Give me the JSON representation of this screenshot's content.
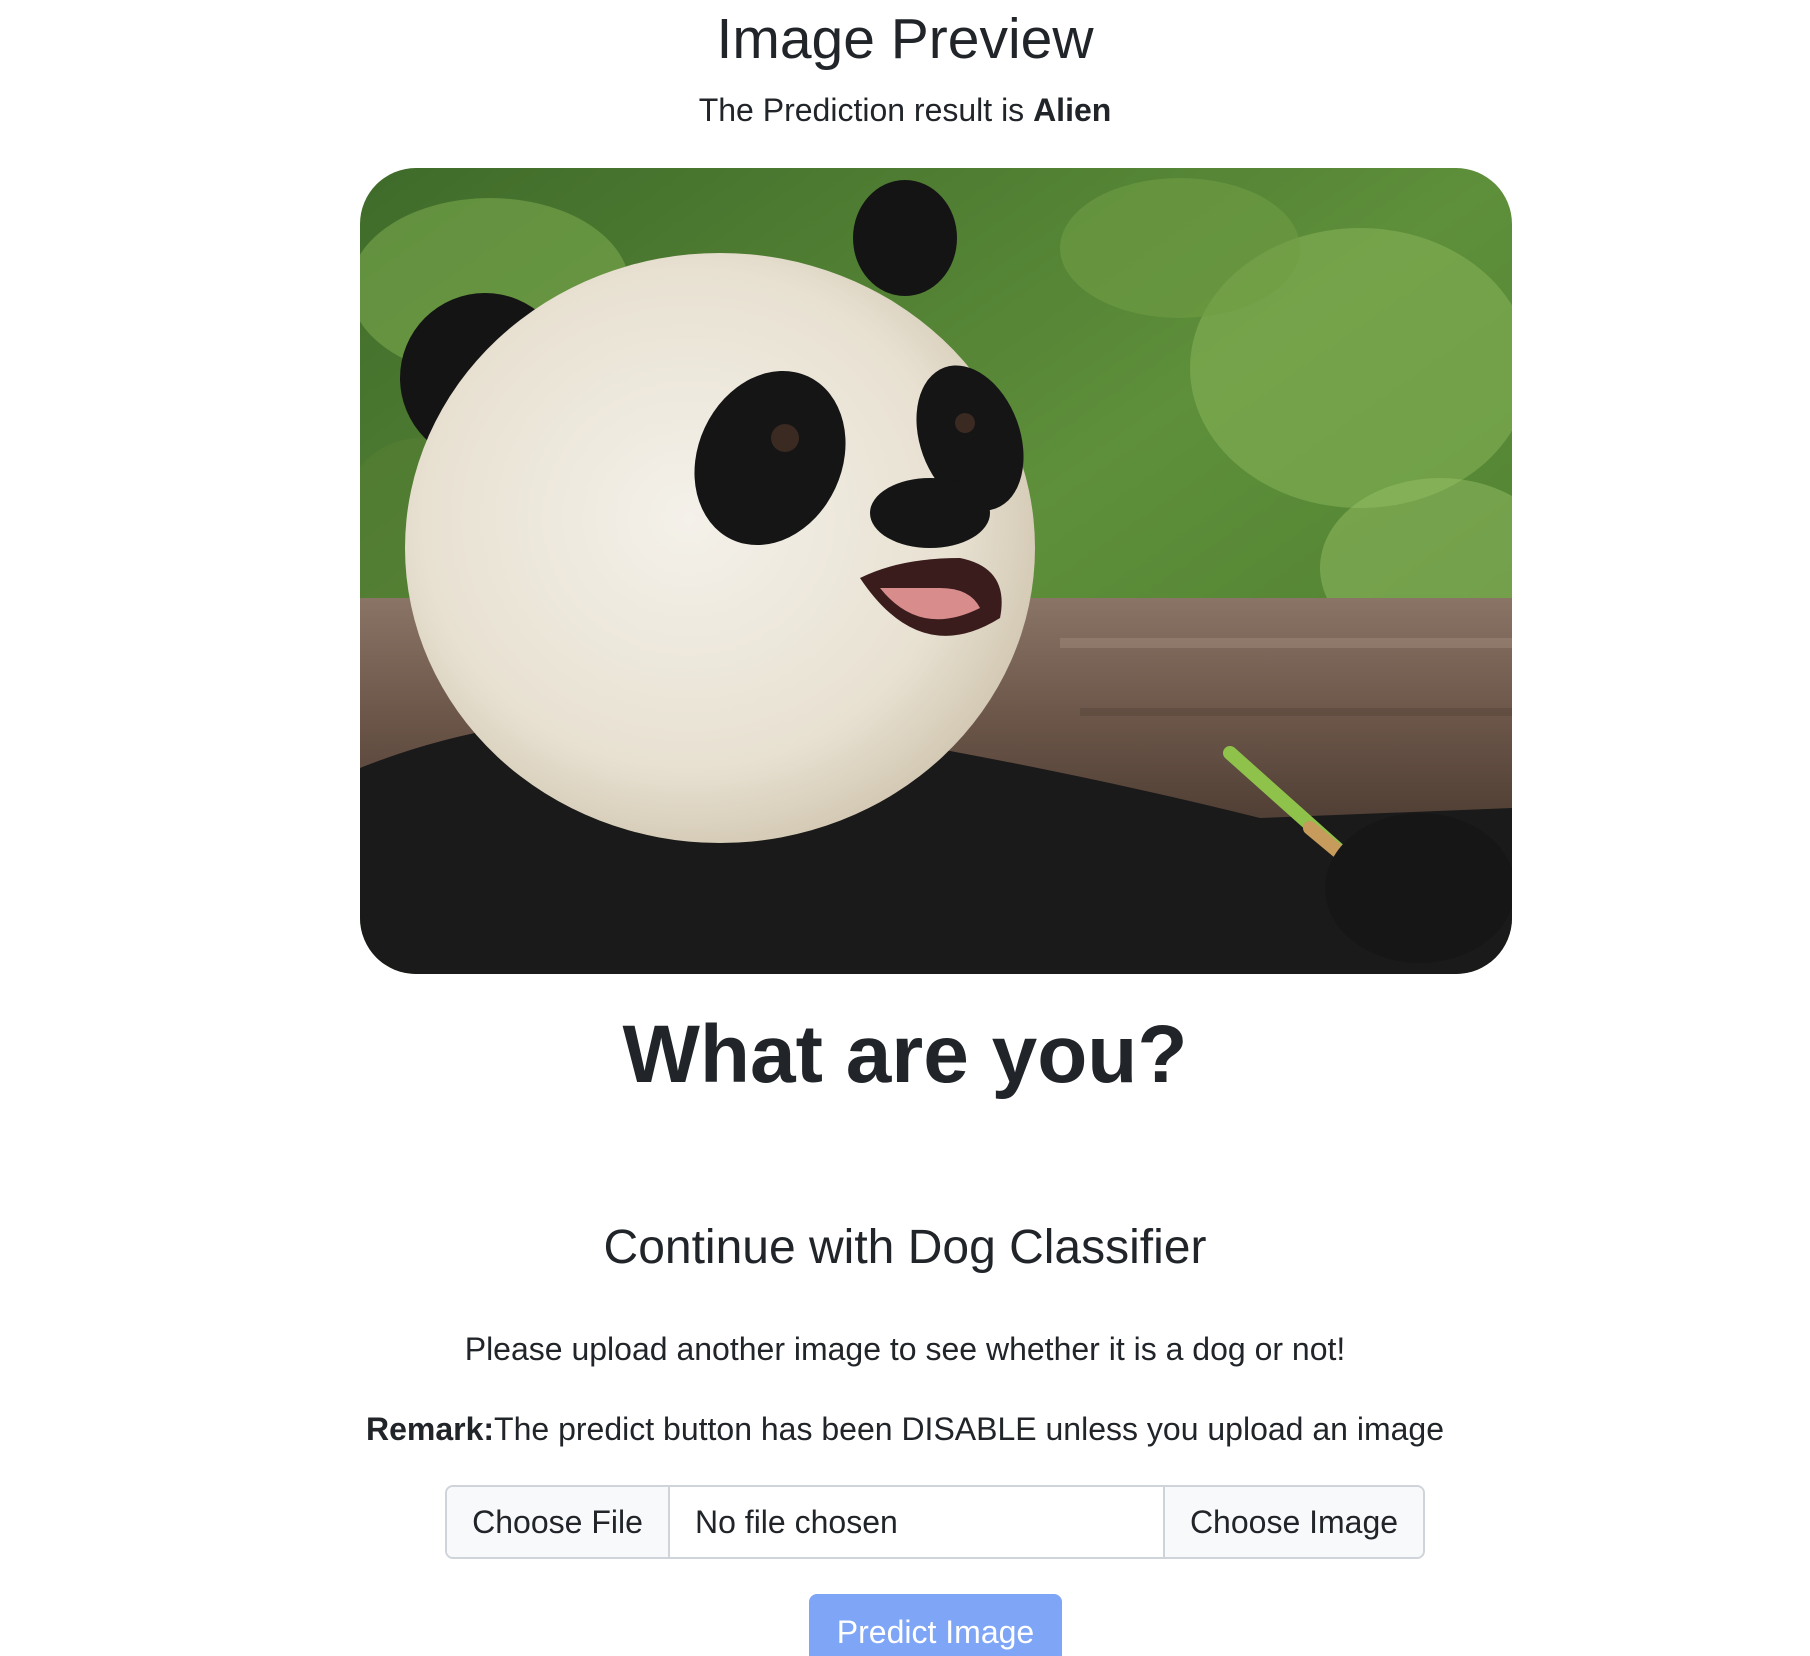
{
  "preview": {
    "title": "Image Preview",
    "prediction_prefix": "The Prediction result is ",
    "prediction_value": "Alien"
  },
  "main": {
    "question": "What are you?",
    "continue_heading": "Continue with Dog Classifier",
    "instruction": "Please upload another image to see whether it is a dog or not!",
    "remark_label": "Remark:",
    "remark_text": "The predict button has been DISABLE unless you upload an image"
  },
  "upload": {
    "choose_file_label": "Choose File",
    "file_status": "No file chosen",
    "addon_label": "Choose Image"
  },
  "predict_button": {
    "label": "Predict Image",
    "disabled": true
  },
  "colors": {
    "text": "#212529",
    "predict_button_bg": "#7fa5f7",
    "input_border": "#ced4da",
    "addon_bg": "#f8f9fa"
  }
}
